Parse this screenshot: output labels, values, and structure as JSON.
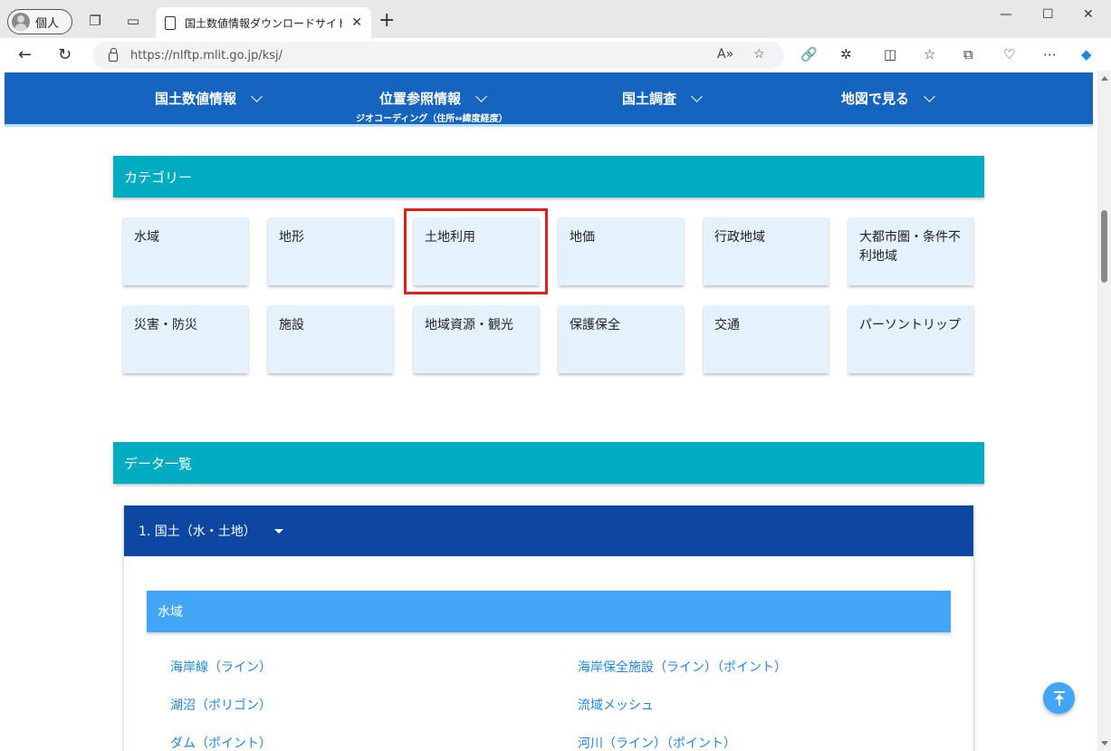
{
  "browser": {
    "profile_label": "個人",
    "tab_title": "国土数値情報ダウンロードサイト",
    "url": "https://nlftp.mlit.go.jp/ksj/"
  },
  "site_nav": {
    "items": [
      {
        "label": "国土数値情報"
      },
      {
        "label": "位置参照情報"
      },
      {
        "label": "国土調査"
      },
      {
        "label": "地図で見る"
      }
    ],
    "sub_label": "ジオコーディング（住所⇔緯度経度）"
  },
  "categories": {
    "heading": "カテゴリー",
    "items": [
      "水域",
      "地形",
      "土地利用",
      "地価",
      "行政地域",
      "大都市圏・条件不利地域",
      "災害・防災",
      "施設",
      "地域資源・観光",
      "保護保全",
      "交通",
      "パーソントリップ"
    ],
    "highlighted": "土地利用"
  },
  "data_list": {
    "heading": "データ一覧",
    "panel_title": "1. 国土（水・土地）",
    "subsection": "水域",
    "links": [
      "海岸線（ライン）",
      "海岸保全施設（ライン）（ポイント）",
      "湖沼（ポリゴン）",
      "流域メッシュ",
      "ダム（ポイント）",
      "河川（ライン）（ポイント）"
    ]
  }
}
